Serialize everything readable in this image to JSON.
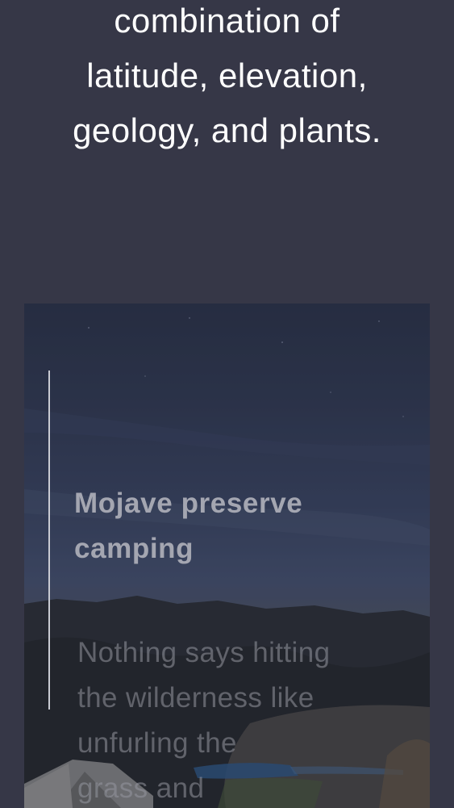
{
  "intro": {
    "lines": [
      "combination of",
      "latitude, elevation,",
      "geology, and plants."
    ]
  },
  "card": {
    "title_lines": [
      "Mojave preserve",
      "camping"
    ],
    "body_lines": [
      "Nothing says hitting",
      "the wilderness like",
      "unfurling the",
      "grass and"
    ]
  },
  "colors": {
    "background": "#363747",
    "text": "#ffffff",
    "card_title": "#a4a6b1"
  }
}
